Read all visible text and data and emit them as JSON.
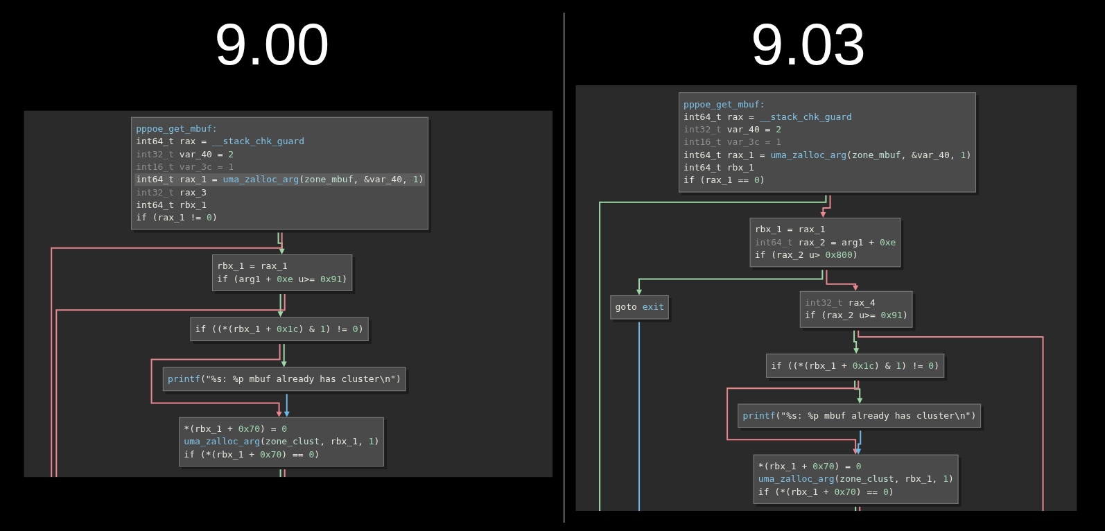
{
  "panels": [
    {
      "title": "9.00",
      "blocks": [
        {
          "lines": [
            {
              "selected": false,
              "tokens": [
                {
                  "kind": "func",
                  "text": "pppoe_get_mbuf:"
                }
              ]
            },
            {
              "selected": false,
              "tokens": [
                {
                  "kind": "text",
                  "text": "int64_t rax = "
                },
                {
                  "kind": "func",
                  "text": "__stack_chk_guard"
                }
              ]
            },
            {
              "selected": false,
              "tokens": [
                {
                  "kind": "dim",
                  "text": "int32_t "
                },
                {
                  "kind": "text",
                  "text": "var_40 = "
                },
                {
                  "kind": "num",
                  "text": "2"
                }
              ]
            },
            {
              "selected": false,
              "tokens": [
                {
                  "kind": "dim",
                  "text": "int16_t var_3c = 1"
                }
              ]
            },
            {
              "selected": true,
              "tokens": [
                {
                  "kind": "text",
                  "text": "int64_t rax_1 = "
                },
                {
                  "kind": "func",
                  "text": "uma_zalloc_arg"
                },
                {
                  "kind": "text",
                  "text": "("
                },
                {
                  "kind": "data",
                  "text": "zone_mbuf"
                },
                {
                  "kind": "text",
                  "text": ", &var_40, "
                },
                {
                  "kind": "num",
                  "text": "1"
                },
                {
                  "kind": "text",
                  "text": ")"
                }
              ]
            },
            {
              "selected": false,
              "tokens": [
                {
                  "kind": "dim",
                  "text": "int32_t "
                },
                {
                  "kind": "text",
                  "text": "rax_3"
                }
              ]
            },
            {
              "selected": false,
              "tokens": [
                {
                  "kind": "text",
                  "text": "int64_t rbx_1"
                }
              ]
            },
            {
              "selected": false,
              "tokens": [
                {
                  "kind": "text",
                  "text": "if (rax_1 != "
                },
                {
                  "kind": "num",
                  "text": "0"
                },
                {
                  "kind": "text",
                  "text": ")"
                }
              ]
            }
          ]
        },
        {
          "lines": [
            {
              "selected": false,
              "tokens": [
                {
                  "kind": "text",
                  "text": "rbx_1 = rax_1"
                }
              ]
            },
            {
              "selected": false,
              "tokens": [
                {
                  "kind": "text",
                  "text": "if (arg1 + "
                },
                {
                  "kind": "num",
                  "text": "0xe"
                },
                {
                  "kind": "text",
                  "text": " u>= "
                },
                {
                  "kind": "num",
                  "text": "0x91"
                },
                {
                  "kind": "text",
                  "text": ")"
                }
              ]
            }
          ]
        },
        {
          "lines": [
            {
              "selected": false,
              "tokens": [
                {
                  "kind": "text",
                  "text": "if ((*(rbx_1 + "
                },
                {
                  "kind": "num",
                  "text": "0x1c"
                },
                {
                  "kind": "text",
                  "text": ") & "
                },
                {
                  "kind": "num",
                  "text": "1"
                },
                {
                  "kind": "text",
                  "text": ") != "
                },
                {
                  "kind": "num",
                  "text": "0"
                },
                {
                  "kind": "text",
                  "text": ")"
                }
              ]
            }
          ]
        },
        {
          "lines": [
            {
              "selected": false,
              "tokens": [
                {
                  "kind": "func",
                  "text": "printf"
                },
                {
                  "kind": "text",
                  "text": "(\"%s: %p mbuf already has cluster\\n\")"
                }
              ]
            }
          ]
        },
        {
          "lines": [
            {
              "selected": false,
              "tokens": [
                {
                  "kind": "text",
                  "text": "*(rbx_1 + "
                },
                {
                  "kind": "num",
                  "text": "0x70"
                },
                {
                  "kind": "text",
                  "text": ") = "
                },
                {
                  "kind": "num",
                  "text": "0"
                }
              ]
            },
            {
              "selected": false,
              "tokens": [
                {
                  "kind": "func",
                  "text": "uma_zalloc_arg"
                },
                {
                  "kind": "text",
                  "text": "("
                },
                {
                  "kind": "data",
                  "text": "zone_clust"
                },
                {
                  "kind": "text",
                  "text": ", rbx_1, "
                },
                {
                  "kind": "num",
                  "text": "1"
                },
                {
                  "kind": "text",
                  "text": ")"
                }
              ]
            },
            {
              "selected": false,
              "tokens": [
                {
                  "kind": "text",
                  "text": "if (*(rbx_1 + "
                },
                {
                  "kind": "num",
                  "text": "0x70"
                },
                {
                  "kind": "text",
                  "text": ") == "
                },
                {
                  "kind": "num",
                  "text": "0"
                },
                {
                  "kind": "text",
                  "text": ")"
                }
              ]
            }
          ]
        }
      ]
    },
    {
      "title": "9.03",
      "blocks": [
        {
          "lines": [
            {
              "selected": false,
              "tokens": [
                {
                  "kind": "func",
                  "text": "pppoe_get_mbuf:"
                }
              ]
            },
            {
              "selected": false,
              "tokens": [
                {
                  "kind": "text",
                  "text": "int64_t rax = "
                },
                {
                  "kind": "func",
                  "text": "__stack_chk_guard"
                }
              ]
            },
            {
              "selected": false,
              "tokens": [
                {
                  "kind": "dim",
                  "text": "int32_t "
                },
                {
                  "kind": "text",
                  "text": "var_40 = "
                },
                {
                  "kind": "num",
                  "text": "2"
                }
              ]
            },
            {
              "selected": false,
              "tokens": [
                {
                  "kind": "dim",
                  "text": "int16_t var_3c = 1"
                }
              ]
            },
            {
              "selected": false,
              "tokens": [
                {
                  "kind": "text",
                  "text": "int64_t rax_1 = "
                },
                {
                  "kind": "func",
                  "text": "uma_zalloc_arg"
                },
                {
                  "kind": "text",
                  "text": "("
                },
                {
                  "kind": "data",
                  "text": "zone_mbuf"
                },
                {
                  "kind": "text",
                  "text": ", &var_40, "
                },
                {
                  "kind": "num",
                  "text": "1"
                },
                {
                  "kind": "text",
                  "text": ")"
                }
              ]
            },
            {
              "selected": false,
              "tokens": [
                {
                  "kind": "text",
                  "text": "int64_t rbx_1"
                }
              ]
            },
            {
              "selected": false,
              "tokens": [
                {
                  "kind": "text",
                  "text": "if (rax_1 == "
                },
                {
                  "kind": "num",
                  "text": "0"
                },
                {
                  "kind": "text",
                  "text": ")"
                }
              ]
            }
          ]
        },
        {
          "lines": [
            {
              "selected": false,
              "tokens": [
                {
                  "kind": "text",
                  "text": "rbx_1 = rax_1"
                }
              ]
            },
            {
              "selected": false,
              "tokens": [
                {
                  "kind": "dim",
                  "text": "int64_t "
                },
                {
                  "kind": "text",
                  "text": "rax_2 = arg1 + "
                },
                {
                  "kind": "num",
                  "text": "0xe"
                }
              ]
            },
            {
              "selected": false,
              "tokens": [
                {
                  "kind": "text",
                  "text": "if (rax_2 u> "
                },
                {
                  "kind": "num",
                  "text": "0x800"
                },
                {
                  "kind": "text",
                  "text": ")"
                }
              ]
            }
          ]
        },
        {
          "lines": [
            {
              "selected": false,
              "tokens": [
                {
                  "kind": "text",
                  "text": "goto "
                },
                {
                  "kind": "func",
                  "text": "exit"
                }
              ]
            }
          ]
        },
        {
          "lines": [
            {
              "selected": false,
              "tokens": [
                {
                  "kind": "dim",
                  "text": "int32_t "
                },
                {
                  "kind": "text",
                  "text": "rax_4"
                }
              ]
            },
            {
              "selected": false,
              "tokens": [
                {
                  "kind": "text",
                  "text": "if (rax_2 u>= "
                },
                {
                  "kind": "num",
                  "text": "0x91"
                },
                {
                  "kind": "text",
                  "text": ")"
                }
              ]
            }
          ]
        },
        {
          "lines": [
            {
              "selected": false,
              "tokens": [
                {
                  "kind": "text",
                  "text": "if ((*(rbx_1 + "
                },
                {
                  "kind": "num",
                  "text": "0x1c"
                },
                {
                  "kind": "text",
                  "text": ") & "
                },
                {
                  "kind": "num",
                  "text": "1"
                },
                {
                  "kind": "text",
                  "text": ") != "
                },
                {
                  "kind": "num",
                  "text": "0"
                },
                {
                  "kind": "text",
                  "text": ")"
                }
              ]
            }
          ]
        },
        {
          "lines": [
            {
              "selected": false,
              "tokens": [
                {
                  "kind": "func",
                  "text": "printf"
                },
                {
                  "kind": "text",
                  "text": "(\"%s: %p mbuf already has cluster\\n\")"
                }
              ]
            }
          ]
        },
        {
          "lines": [
            {
              "selected": false,
              "tokens": [
                {
                  "kind": "text",
                  "text": "*(rbx_1 + "
                },
                {
                  "kind": "num",
                  "text": "0x70"
                },
                {
                  "kind": "text",
                  "text": ") = "
                },
                {
                  "kind": "num",
                  "text": "0"
                }
              ]
            },
            {
              "selected": false,
              "tokens": [
                {
                  "kind": "func",
                  "text": "uma_zalloc_arg"
                },
                {
                  "kind": "text",
                  "text": "("
                },
                {
                  "kind": "data",
                  "text": "zone_clust"
                },
                {
                  "kind": "text",
                  "text": ", rbx_1, "
                },
                {
                  "kind": "num",
                  "text": "1"
                },
                {
                  "kind": "text",
                  "text": ")"
                }
              ]
            },
            {
              "selected": false,
              "tokens": [
                {
                  "kind": "text",
                  "text": "if (*(rbx_1 + "
                },
                {
                  "kind": "num",
                  "text": "0x70"
                },
                {
                  "kind": "text",
                  "text": ") == "
                },
                {
                  "kind": "num",
                  "text": "0"
                },
                {
                  "kind": "text",
                  "text": ")"
                }
              ]
            }
          ]
        }
      ]
    }
  ]
}
